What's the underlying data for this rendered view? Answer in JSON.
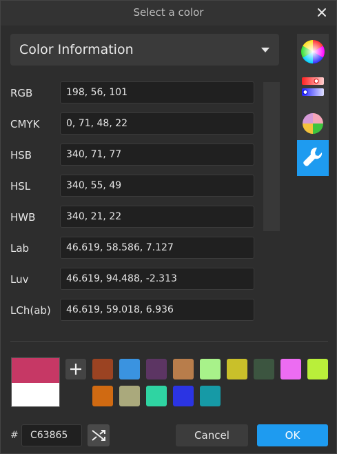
{
  "dialog": {
    "title": "Select a color",
    "close_icon": "close-icon"
  },
  "mode_dropdown": {
    "label": "Color Information",
    "icon": "chevron-down-icon"
  },
  "color_info": [
    {
      "label": "RGB",
      "value": "198, 56, 101"
    },
    {
      "label": "CMYK",
      "value": "0, 71, 48, 22"
    },
    {
      "label": "HSB",
      "value": "340, 71, 77"
    },
    {
      "label": "HSL",
      "value": "340, 55, 49"
    },
    {
      "label": "HWB",
      "value": "340, 21, 22"
    },
    {
      "label": "Lab",
      "value": "46.619, 58.586, 7.127"
    },
    {
      "label": "Luv",
      "value": "46.619, 94.488, -2.313"
    },
    {
      "label": "LCh(ab)",
      "value": "46.619, 59.018, 6.936"
    }
  ],
  "side_tools": [
    {
      "icon": "color-wheel-icon",
      "active": false
    },
    {
      "icon": "sliders-icon",
      "active": false
    },
    {
      "icon": "color-harmony-icon",
      "active": false
    },
    {
      "icon": "wrench-icon",
      "active": true
    }
  ],
  "preview": {
    "new_color": "#c63865",
    "old_color": "#ffffff"
  },
  "swatches": {
    "add_icon": "plus-icon",
    "colors": [
      "#9b4322",
      "#3a93e0",
      "#5c3563",
      "#b87d4b",
      "#a8f28a",
      "#c9c02a",
      "#3c5540",
      "#ec6cf2",
      "#b9ef3a",
      "#d06a12",
      "#aaa97c",
      "#2fd4a2",
      "#2b34e3",
      "#169aa6"
    ]
  },
  "hex": {
    "prefix": "#",
    "value": "C63865",
    "shuffle_icon": "shuffle-icon"
  },
  "buttons": {
    "cancel": "Cancel",
    "ok": "OK"
  },
  "accent_color": "#1e9bf0"
}
